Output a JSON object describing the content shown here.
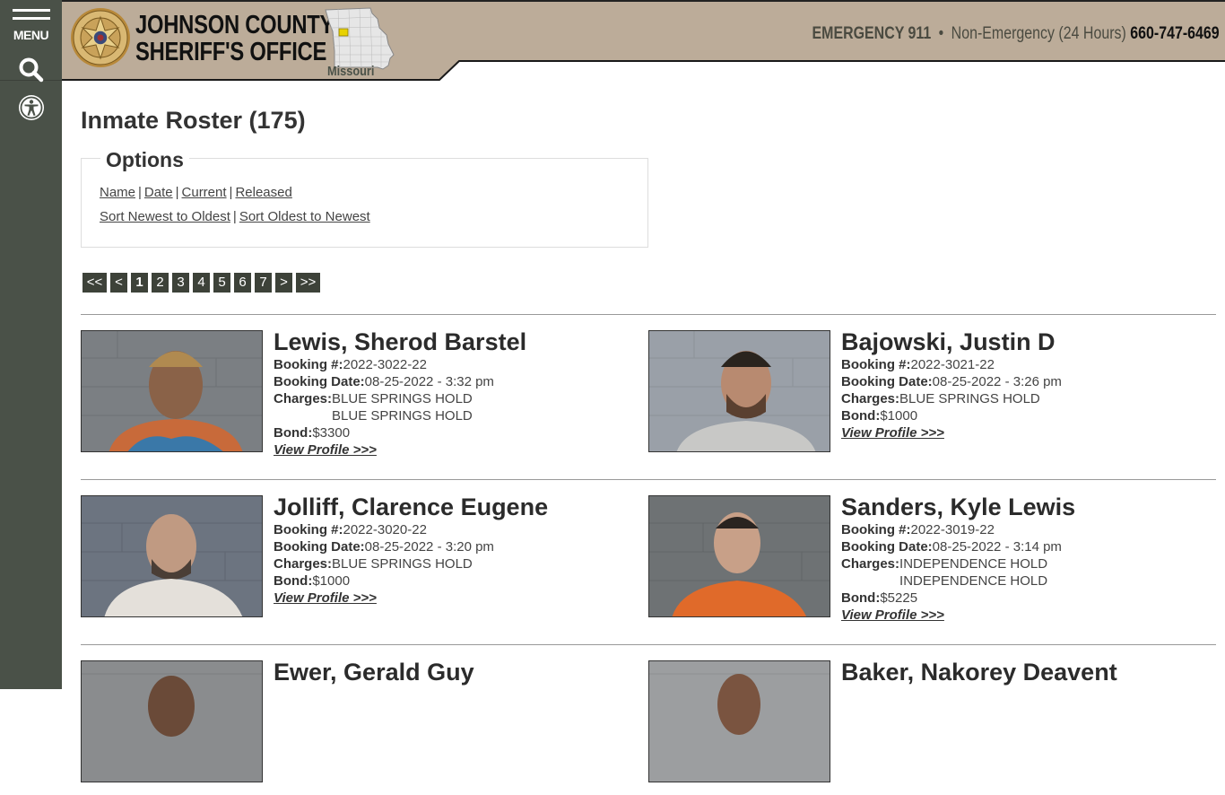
{
  "sidebar": {
    "menu_label": "MENU",
    "icons": [
      "menu-icon",
      "search-icon",
      "accessibility-icon"
    ]
  },
  "header": {
    "title_line1": "JOHNSON COUNTY",
    "title_line2": "SHERIFF'S OFFICE",
    "badge_icon": "sheriff-star-badge",
    "state_label": "Missouri",
    "emergency": "EMERGENCY 911",
    "separator": "•",
    "non_emergency_label": "Non-Emergency (24 Hours)",
    "phone": "660-747-6469",
    "colors": {
      "band": "#bcac99",
      "sidebar": "#4a5148",
      "highlight_county": "#e8d200"
    }
  },
  "page": {
    "title": "Inmate Roster (175)"
  },
  "options": {
    "legend": "Options",
    "filters": [
      "Name",
      "Date",
      "Current",
      "Released"
    ],
    "sorts": [
      "Sort Newest to Oldest",
      "Sort Oldest to Newest"
    ],
    "separator": "|"
  },
  "pager": {
    "first": "<<",
    "prev": "<",
    "pages": [
      "1",
      "2",
      "3",
      "4",
      "5",
      "6",
      "7"
    ],
    "current": "1",
    "next": ">",
    "last": ">>"
  },
  "labels": {
    "booking_num": "Booking #:",
    "booking_date": "Booking Date:",
    "charges": "Charges:",
    "bond": "Bond:",
    "view_profile": "View Profile >>>"
  },
  "inmates": [
    {
      "name": "Lewis, Sherod Barstel",
      "booking_num": "2022-3022-22",
      "booking_date": "08-25-2022 - 3:32 pm",
      "charges": [
        "BLUE SPRINGS HOLD",
        "BLUE SPRINGS HOLD"
      ],
      "bond": "$3300"
    },
    {
      "name": "Bajowski, Justin D",
      "booking_num": "2022-3021-22",
      "booking_date": "08-25-2022 - 3:26 pm",
      "charges": [
        "BLUE SPRINGS HOLD"
      ],
      "bond": "$1000"
    },
    {
      "name": "Jolliff, Clarence Eugene",
      "booking_num": "2022-3020-22",
      "booking_date": "08-25-2022 - 3:20 pm",
      "charges": [
        "BLUE SPRINGS HOLD"
      ],
      "bond": "$1000"
    },
    {
      "name": "Sanders, Kyle Lewis",
      "booking_num": "2022-3019-22",
      "booking_date": "08-25-2022 - 3:14 pm",
      "charges": [
        "INDEPENDENCE HOLD",
        "INDEPENDENCE HOLD"
      ],
      "bond": "$5225"
    },
    {
      "name": "Ewer, Gerald Guy"
    },
    {
      "name": "Baker, Nakorey Deavent"
    }
  ]
}
